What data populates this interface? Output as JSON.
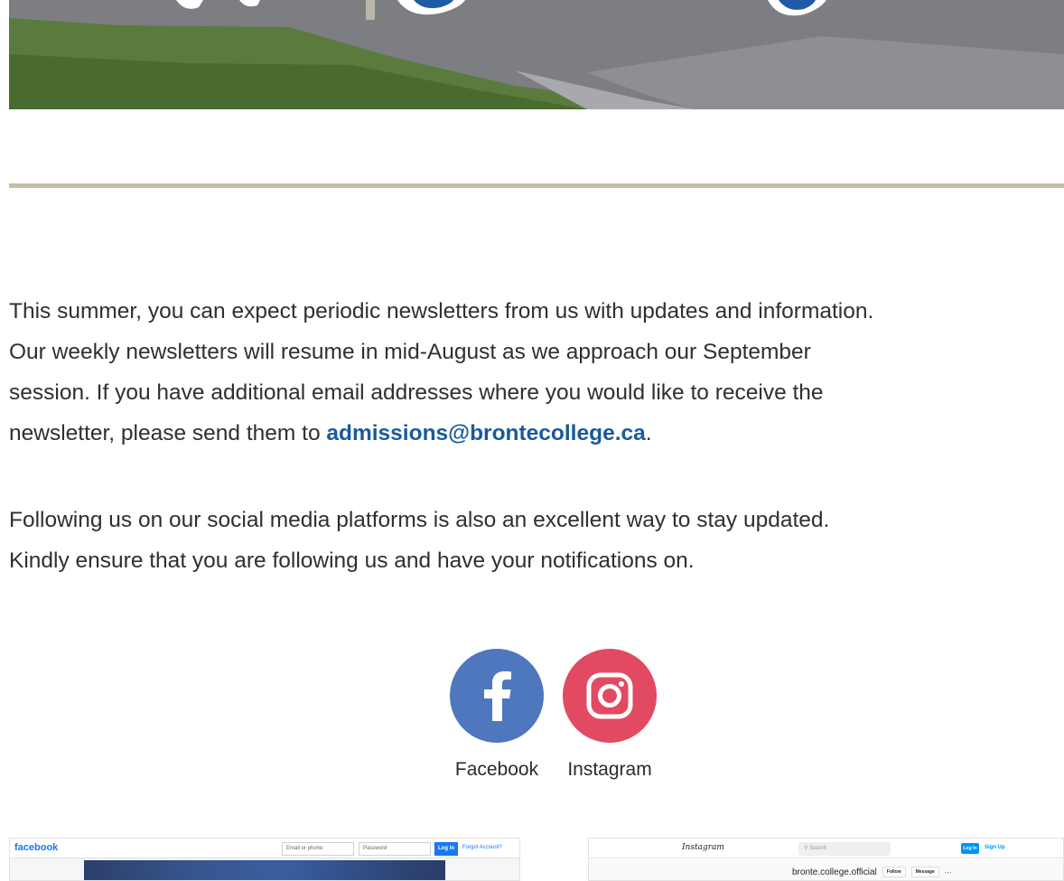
{
  "paragraphs": {
    "first": {
      "line1": "This summer, you can expect periodic newsletters from us with updates and information.",
      "line2": "Our weekly newsletters will resume in mid-August as we approach our September",
      "line3": "session. If you have additional email addresses where you would like to receive the",
      "line4_before": "newsletter, please send them to ",
      "email": "admissions@brontecollege.ca",
      "line4_after": "."
    },
    "second": {
      "line1": "Following us on our social media platforms is also an excellent way to stay updated.",
      "line2": "Kindly ensure that you are following us and have your notifications on."
    }
  },
  "social": {
    "facebook": {
      "label": "Facebook",
      "icon": "facebook-icon",
      "color": "#4f77bd"
    },
    "instagram": {
      "label": "Instagram",
      "icon": "instagram-icon",
      "color": "#e24a61"
    }
  },
  "facebook_preview": {
    "logo": "facebook",
    "email_placeholder": "Email or phone",
    "password_placeholder": "Password",
    "login_label": "Log In",
    "forgot_label": "Forgot Account?"
  },
  "instagram_preview": {
    "logo": "Instagram",
    "search_placeholder": "Search",
    "login_label": "Log In",
    "signup_label": "Sign Up",
    "handle": "bronte.college.official",
    "follow_label": "Follow",
    "message_label": "Message",
    "more_label": "···"
  },
  "colors": {
    "link": "#1a5a9a",
    "divider": "#c6bda9"
  }
}
